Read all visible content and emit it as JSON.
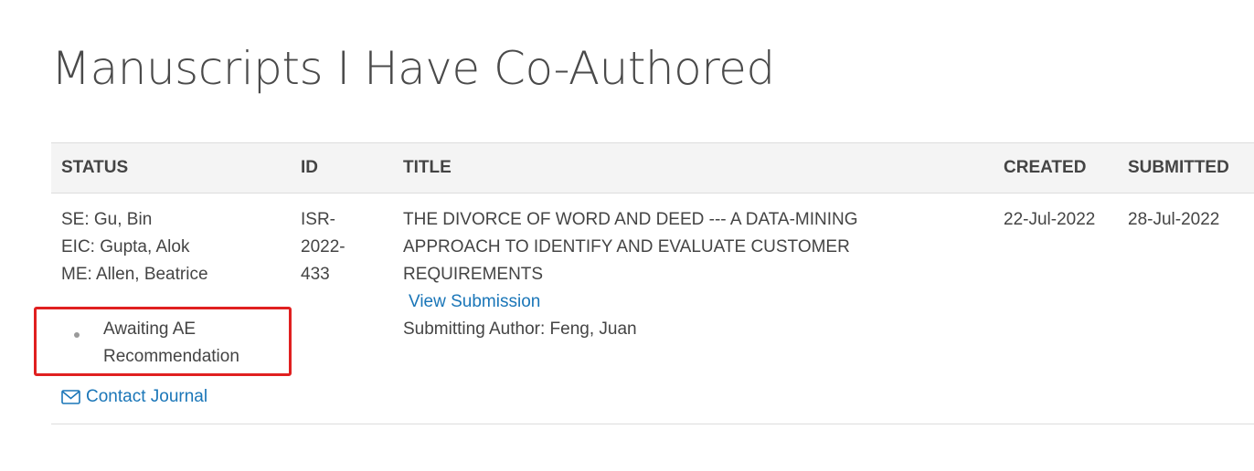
{
  "page": {
    "title": "Manuscripts I Have Co-Authored"
  },
  "table": {
    "headers": {
      "status": "STATUS",
      "id": "ID",
      "title": "TITLE",
      "created": "CREATED",
      "submitted": "SUBMITTED"
    },
    "rows": [
      {
        "editors": [
          "SE: Gu, Bin",
          "EIC: Gupta, Alok",
          "ME: Allen, Beatrice"
        ],
        "status": "Awaiting AE Recommendation",
        "contact_label": "Contact Journal",
        "contact_icon": "envelope-icon",
        "id_lines": [
          "ISR-",
          "2022-",
          "433"
        ],
        "title": "THE DIVORCE OF WORD AND DEED --- A DATA-MINING APPROACH TO IDENTIFY AND EVALUATE CUSTOMER REQUIREMENTS",
        "view_label": "View Submission",
        "submitting_author": "Submitting Author: Feng, Juan",
        "created": "22-Jul-2022",
        "submitted": "28-Jul-2022"
      }
    ]
  },
  "colors": {
    "link": "#1a76b8",
    "highlight_border": "#e02020",
    "header_bg": "#f4f4f4"
  }
}
